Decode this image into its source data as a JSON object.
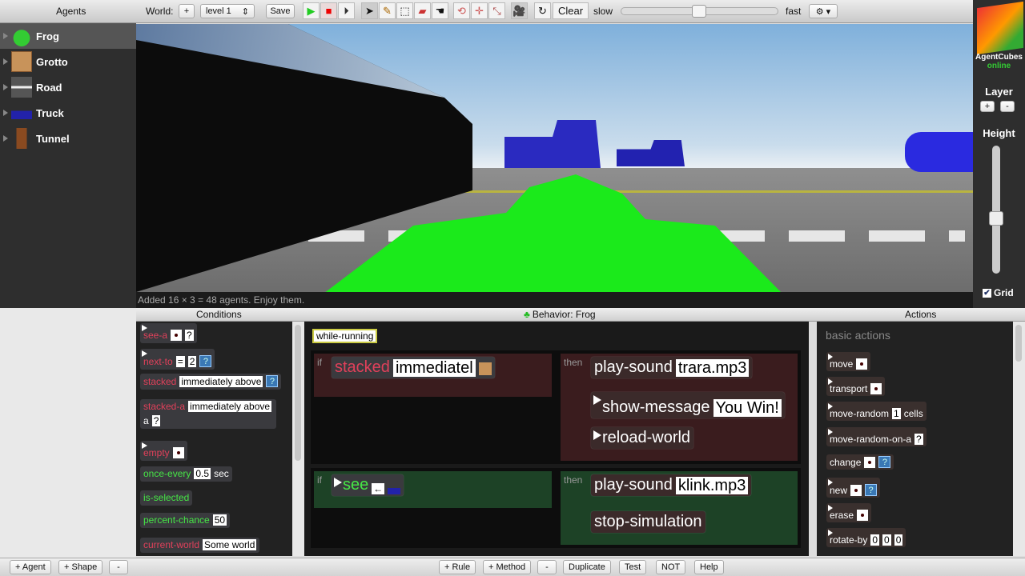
{
  "toolbar": {
    "agents_label": "Agents",
    "world_label": "World:",
    "add_world": "+",
    "level_select": "level 1",
    "save": "Save",
    "clear": "Clear",
    "slow": "slow",
    "fast": "fast",
    "speed": 0.5,
    "tool_icons": [
      "play-icon",
      "stop-icon",
      "step-icon",
      "pointer-icon",
      "pencil-icon",
      "select-rect-icon",
      "eraser-icon",
      "hand-icon",
      "rotate-icon",
      "move-icon",
      "scale-icon",
      "camera-icon",
      "reset-icon",
      "gear-icon"
    ]
  },
  "agents": [
    {
      "name": "Frog",
      "selected": true
    },
    {
      "name": "Grotto"
    },
    {
      "name": "Road"
    },
    {
      "name": "Truck"
    },
    {
      "name": "Tunnel"
    }
  ],
  "status": "Added 16 × 3 = 48 agents. Enjoy them.",
  "right_panel": {
    "brand": "AgentCubes",
    "brand_sub": "online",
    "layer": "Layer",
    "layer_plus": "+",
    "layer_minus": "-",
    "height": "Height",
    "height_value": 0.4,
    "grid": "Grid",
    "grid_checked": true
  },
  "panel_headers": {
    "conditions": "Conditions",
    "behavior": "Behavior: Frog",
    "actions": "Actions"
  },
  "conditions": [
    {
      "name": "see-a",
      "q": "?"
    },
    {
      "name": "next-to",
      "op": "=",
      "num": "2",
      "q": "?"
    },
    {
      "name": "stacked",
      "val": "immediately above",
      "q": "?"
    },
    {
      "name": "stacked-a",
      "val": "immediately above",
      "extra": "a",
      "q": "?"
    },
    {
      "name": "empty"
    },
    {
      "name": "once-every",
      "val": "0.5",
      "unit": "sec"
    },
    {
      "name": "is-selected"
    },
    {
      "name": "percent-chance",
      "val": "50"
    },
    {
      "name": "current-world",
      "val": "Some world"
    }
  ],
  "behavior": {
    "method": "while-running",
    "if_label": "if",
    "then_label": "then",
    "rule1": {
      "condition": "stacked",
      "cond_value": "immediatel",
      "actions": [
        {
          "name": "play-sound",
          "val": "trara.mp3"
        },
        {
          "name": "show-message",
          "val": "You Win!"
        },
        {
          "name": "reload-world"
        }
      ]
    },
    "rule2": {
      "condition": "see",
      "actions": [
        {
          "name": "play-sound",
          "val": "klink.mp3"
        },
        {
          "name": "stop-simulation"
        }
      ]
    }
  },
  "actions": {
    "section": "basic actions",
    "items": [
      {
        "name": "move"
      },
      {
        "name": "transport"
      },
      {
        "name": "move-random",
        "val": "1",
        "unit": "cells"
      },
      {
        "name": "move-random-on-a",
        "q": "?"
      },
      {
        "name": "change",
        "q": "?"
      },
      {
        "name": "new",
        "q": "?"
      },
      {
        "name": "erase"
      },
      {
        "name": "rotate-by",
        "v1": "0",
        "v2": "0",
        "v3": "0"
      }
    ]
  },
  "bottom": {
    "add_agent": "+ Agent",
    "add_shape": "+ Shape",
    "remove": "-",
    "add_rule": "+ Rule",
    "add_method": "+ Method",
    "remove_rule": "-",
    "duplicate": "Duplicate",
    "test": "Test",
    "not": "NOT",
    "help": "Help"
  },
  "colors": {
    "condition_red": "#e0405a",
    "condition_green": "#46e646",
    "rule1_bg": "#3a1c1e",
    "rule2_bg": "#1d4226"
  }
}
